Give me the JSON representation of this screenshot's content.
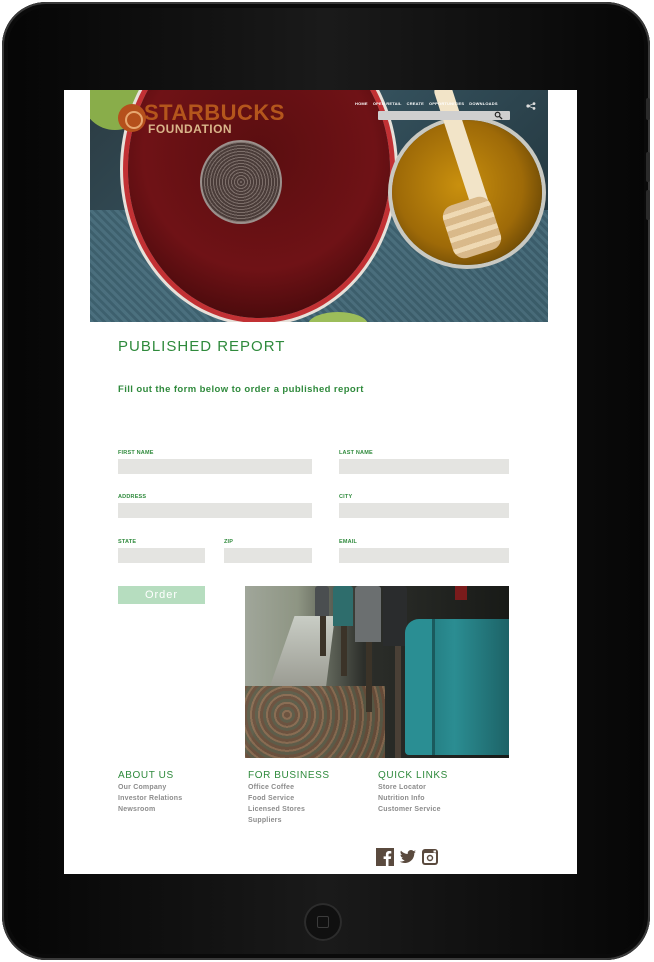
{
  "brand": {
    "name_line1": "STARBUCKS",
    "name_line2": "FOUNDATION",
    "accent": "#2f8a3c"
  },
  "nav": {
    "items": [
      "HOME",
      "OPEN RETAIL",
      "CREATE",
      "OPPORTUNITIES",
      "DOWNLOADS"
    ]
  },
  "search": {
    "value": ""
  },
  "page": {
    "title": "PUBLISHED REPORT",
    "subtitle": "Fill out the form below to order a published report"
  },
  "form": {
    "first_name": {
      "label": "FIRST NAME",
      "value": ""
    },
    "last_name": {
      "label": "LAST NAME",
      "value": ""
    },
    "address": {
      "label": "ADDRESS",
      "value": ""
    },
    "city": {
      "label": "CITY",
      "value": ""
    },
    "state": {
      "label": "STATE",
      "value": ""
    },
    "zip": {
      "label": "ZIP",
      "value": ""
    },
    "email": {
      "label": "EMAIL",
      "value": ""
    },
    "order_label": "Order"
  },
  "footer": {
    "about": {
      "heading": "ABOUT US",
      "links": [
        "Our Company",
        "Investor Relations",
        "Newsroom"
      ]
    },
    "business": {
      "heading": "FOR BUSINESS",
      "links": [
        "Office Coffee",
        "Food Service",
        "Licensed Stores",
        "Suppliers"
      ]
    },
    "quick": {
      "heading": "QUICK LINKS",
      "links": [
        "Store Locator",
        "Nutrition Info",
        "Customer Service"
      ]
    },
    "social": [
      "facebook-icon",
      "twitter-icon",
      "instagram-icon"
    ]
  }
}
